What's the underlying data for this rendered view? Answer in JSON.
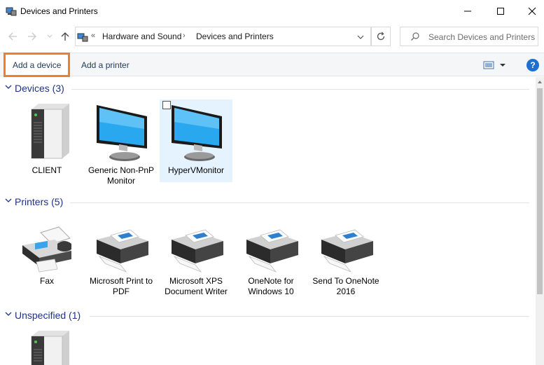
{
  "window": {
    "title": "Devices and Printers"
  },
  "address": {
    "overflow_glyph": "«",
    "crumbs": [
      "Hardware and Sound",
      "Devices and Printers"
    ],
    "separator": "›"
  },
  "search": {
    "placeholder": "Search Devices and Printers"
  },
  "toolbar": {
    "add_device": "Add a device",
    "add_printer": "Add a printer",
    "help": "?"
  },
  "groups": {
    "devices": {
      "title": "Devices (3)",
      "items": [
        {
          "label": "CLIENT",
          "icon": "computer-tower-icon"
        },
        {
          "label": "Generic Non-PnP Monitor",
          "icon": "monitor-icon"
        },
        {
          "label": "HyperVMonitor",
          "icon": "monitor-icon",
          "selected": true
        }
      ]
    },
    "printers": {
      "title": "Printers (5)",
      "items": [
        {
          "label": "Fax",
          "icon": "fax-icon"
        },
        {
          "label": "Microsoft Print to PDF",
          "icon": "printer-icon"
        },
        {
          "label": "Microsoft XPS Document Writer",
          "icon": "printer-icon"
        },
        {
          "label": "OneNote for Windows 10",
          "icon": "printer-icon"
        },
        {
          "label": "Send To OneNote 2016",
          "icon": "printer-icon"
        }
      ]
    },
    "unspecified": {
      "title": "Unspecified (1)",
      "items": [
        {
          "label": "",
          "icon": "computer-tower-icon"
        }
      ]
    }
  },
  "colors": {
    "accent": "#1e3287",
    "highlight_border": "#f07f2c",
    "selection": "#e5f3ff",
    "help": "#1f6fd0"
  }
}
